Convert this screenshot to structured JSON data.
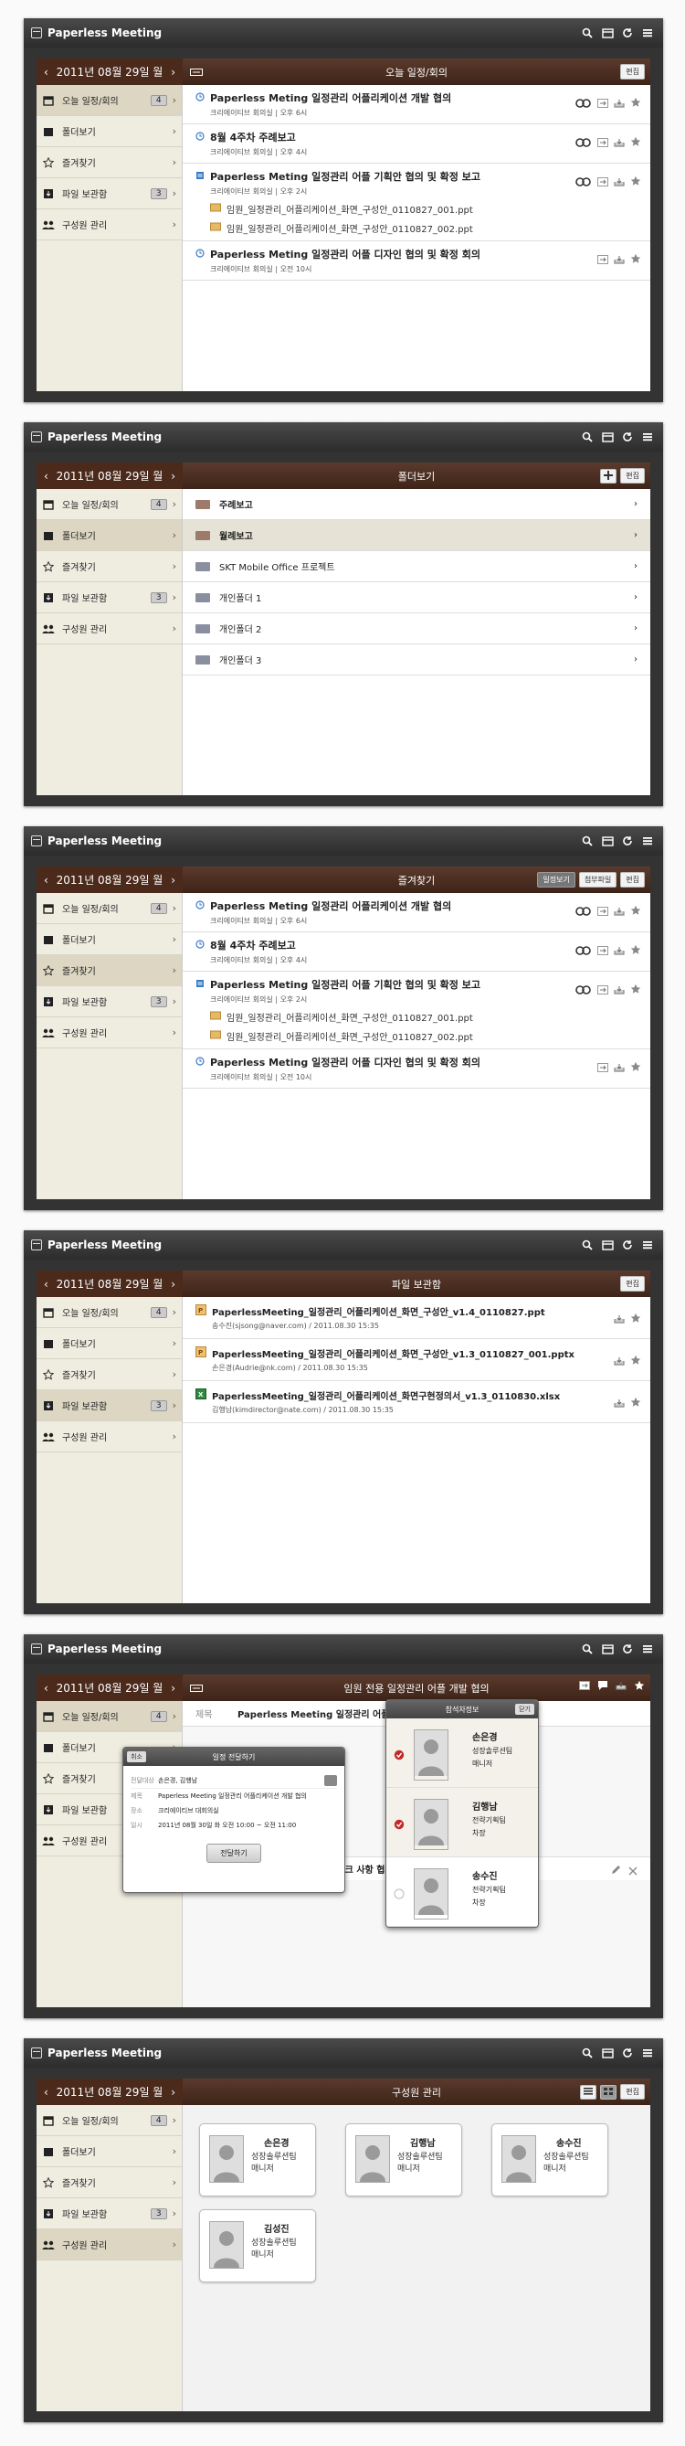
{
  "app": {
    "title": "Paperless Meeting",
    "date": "2011년 08월 29일 월"
  },
  "sidebar": {
    "items": [
      {
        "label": "오늘 일정/회의",
        "badge": "4"
      },
      {
        "label": "폴더보기",
        "badge": ""
      },
      {
        "label": "즐겨찾기",
        "badge": ""
      },
      {
        "label": "파일 보관함",
        "badge": "3"
      },
      {
        "label": "구성원 관리",
        "badge": ""
      }
    ]
  },
  "common": {
    "edit_label": "편집"
  },
  "screen1": {
    "title": "오늘 일정/회의",
    "meetings": [
      {
        "title": "Paperless Meting 일정관리 어플리케이션 개발 협의",
        "sub": "크리에이티브 회의실  |  오후 6시",
        "attachments": []
      },
      {
        "title": "8월 4주차 주례보고",
        "sub": "크리에이티브 회의실  |  오후 4시",
        "attachments": []
      },
      {
        "title": "Paperless Meting 일정관리 어플 기획안 협의 및 확정 보고",
        "sub": "크리에이티브 회의실  |  오후 2시",
        "attachments": [
          "임원_일정관리_어플리케이션_화면_구성안_0110827_001.ppt",
          "임원_일정관리_어플리케이션_화면_구성안_0110827_002.ppt"
        ]
      },
      {
        "title": "Paperless Meting 일정관리 어플 디자인 협의 및 확정 회의",
        "sub": "크리에이티브 회의실  |  오전 10시",
        "attachments": []
      }
    ]
  },
  "screen2": {
    "title": "폴더보기",
    "folders": [
      "주례보고",
      "월례보고",
      "SKT Mobile Office 프로젝트",
      "개인폴더 1",
      "개인폴더 2",
      "개인폴더 3"
    ]
  },
  "screen3": {
    "title": "즐겨찾기",
    "tab1": "일정보기",
    "tab2": "첨부파일",
    "meetings": [
      {
        "title": "Paperless Meting 일정관리 어플리케이션 개발 협의",
        "sub": "크리에이티브 회의실  |  오후 6시",
        "attachments": []
      },
      {
        "title": "8월 4주차 주례보고",
        "sub": "크리에이티브 회의실  |  오후 4시",
        "attachments": []
      },
      {
        "title": "Paperless Meting 일정관리 어플 기획안 협의 및 확정 보고",
        "sub": "크리에이티브 회의실  |  오후 2시",
        "attachments": [
          "임원_일정관리_어플리케이션_화면_구성안_0110827_001.ppt",
          "임원_일정관리_어플리케이션_화면_구성안_0110827_002.ppt"
        ]
      },
      {
        "title": "Paperless Meting 일정관리 어플 디자인 협의 및 확정 회의",
        "sub": "크리에이티브 회의실  |  오전 10시",
        "attachments": []
      }
    ]
  },
  "screen4": {
    "title": "파일 보관함",
    "files": [
      {
        "name": "PaperlessMeeting_일정관리_어플리케이션_화면_구성안_v1.4_0110827.ppt",
        "sub": "송수진(sjsong@naver.com) / 2011.08.30 15:35"
      },
      {
        "name": "PaperlessMeeting_일정관리_어플리케이션_화면_구성안_v1.3_0110827_001.pptx",
        "sub": "손은경(Audrie@nk.com) / 2011.08.30 15:35"
      },
      {
        "name": "PaperlessMeeting_일정관리_어플리케이션_화면구현정의서_v1.3_0110830.xlsx",
        "sub": "김행남(kimdirector@nate.com) / 2011.08.30 15:35"
      }
    ]
  },
  "screen5": {
    "title": "임원 전용 일정관리 어플 개발 협의",
    "subject_label": "제목",
    "subject": "Paperless Meeting 일정관리 어플리케이",
    "memo_label": "메모",
    "memo": "오전 10:30 : 작업 일정 체크 사항 협의",
    "bg_rows": [
      ", 2011.08.30 — 오",
      "_화면_구성안_",
      "_화면_구성안_"
    ],
    "popup": {
      "title": "일정 전달하기",
      "cancel": "취소",
      "to_label": "전달대상",
      "to": "손은경, 김행남",
      "subj_label": "제목",
      "subj": "Paperless Meeting 일정관리 어플리케이션 개발 협의",
      "place_label": "장소",
      "place": "크리에이티브 대회의실",
      "date_label": "일시",
      "date": "2011년 08월 30일 화     오전 10:00 ~ 오전 11:00",
      "send": "전달하기"
    },
    "attendees": {
      "title": "참석자정보",
      "button": "닫기",
      "people": [
        {
          "name": "손은경",
          "dept": "성장솔루션팀",
          "role": "매니저"
        },
        {
          "name": "김행남",
          "dept": "전략기획팀",
          "role": "차장"
        },
        {
          "name": "송수진",
          "dept": "전략기획팀",
          "role": "차장"
        }
      ]
    }
  },
  "screen6": {
    "title": "구성원 관리",
    "members": [
      {
        "name": "손은경",
        "dept": "성장솔루션팀",
        "role": "매니저"
      },
      {
        "name": "김행남",
        "dept": "성장솔루션팀",
        "role": "매니저"
      },
      {
        "name": "송수진",
        "dept": "성장솔루션팀",
        "role": "매니저"
      },
      {
        "name": "김성진",
        "dept": "성장솔루션팀",
        "role": "매니저"
      }
    ]
  }
}
